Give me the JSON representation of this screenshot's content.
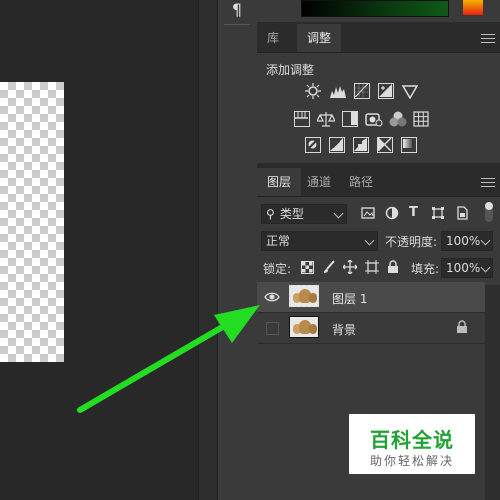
{
  "paragraph_icon": "¶",
  "adjust_panel": {
    "tabs": [
      "库",
      "调整"
    ],
    "active_tab": "调整",
    "add_adjustment_label": "添加调整",
    "icons_row1": [
      "brightness-contrast-icon",
      "levels-icon",
      "curves-icon",
      "exposure-icon",
      "vibrance-icon"
    ],
    "icons_row2": [
      "hue-saturation-icon",
      "color-balance-icon",
      "black-white-icon",
      "photo-filter-icon",
      "channel-mixer-icon",
      "color-lookup-icon"
    ],
    "icons_row3": [
      "invert-icon",
      "posterize-icon",
      "threshold-icon",
      "selective-color-icon",
      "gradient-map-icon"
    ]
  },
  "layers_panel": {
    "tabs": [
      "图层",
      "通道",
      "路径"
    ],
    "active_tab": "图层",
    "filter_kind": "类型",
    "blend_mode": "正常",
    "opacity_label": "不透明度:",
    "opacity_value": "100%",
    "lock_label": "锁定:",
    "fill_label": "填充:",
    "fill_value": "100%",
    "layers": [
      {
        "name": "图层 1",
        "visible": true,
        "selected": true
      },
      {
        "name": "背景",
        "visible": false,
        "selected": false,
        "locked": true
      }
    ]
  },
  "colors": {
    "arrow": "#22dd22",
    "selected_row": "#4a4a4a"
  },
  "watermark": {
    "title": "百科全说",
    "subtitle": "助你轻松解决"
  }
}
